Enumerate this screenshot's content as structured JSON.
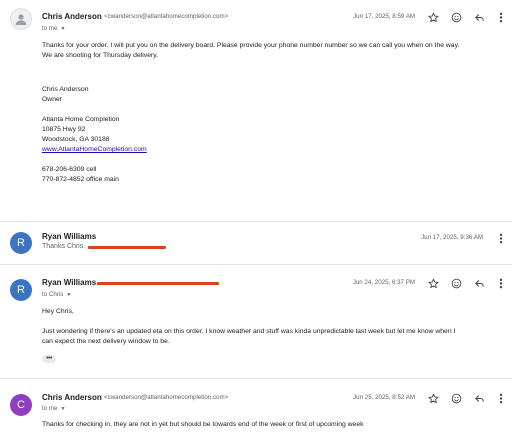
{
  "messages": [
    {
      "sender": "Chris Anderson",
      "email": "<cwanderson@atlantahomecompletion.com>",
      "to": "to me",
      "date": "Jun 17, 2025, 8:59 AM",
      "avatar_type": "default",
      "body": [
        "Thanks for your order. I will put you on the delivery board. Please provide your phone number number so we can call you when on the way.",
        "We are shooting for Thursday delivery."
      ],
      "signature": {
        "name": "Chris Anderson",
        "title": "Owner",
        "company": "Atlanta Home Completion",
        "address1": "10875 Hwy 92",
        "address2": "Woodstock, GA 30188",
        "website": "www.AtlantaHomeCompletion.com",
        "phone_cell": "678-206-6309 cell",
        "phone_office": "770-872-4852 office main"
      }
    },
    {
      "sender": "Ryan Williams",
      "snippet": "Thanks Chris.",
      "date": "Jun 17, 2025, 9:36 AM",
      "avatar_letter": "R",
      "avatar_color": "#3c74c4"
    },
    {
      "sender": "Ryan Williams",
      "to": "to Chris",
      "date": "Jun 24, 2025, 6:37 PM",
      "avatar_letter": "R",
      "avatar_color": "#3c74c4",
      "greeting": "Hey Chris,",
      "body": [
        "Just wondering if there's an updated eta on this order. I know weather and stuff was kinda unpredictable last week but let me know when I",
        "can expect the next delivery window to be."
      ],
      "ellipsis": "•••"
    },
    {
      "sender": "Chris Anderson",
      "email": "<cwanderson@atlantahomecompletion.com>",
      "to": "to me",
      "date": "Jun 25, 2025, 8:52 AM",
      "avatar_letter": "C",
      "avatar_color": "#8e3fbf",
      "body": [
        "Thanks for checking in, they are not in yet but should be towards end of the week or first of upcoming week"
      ]
    }
  ],
  "icons": {
    "star": "star-icon",
    "emoji": "emoji-icon",
    "reply": "reply-icon",
    "more": "more-vert-icon",
    "caret": "chevron-down-icon"
  },
  "colors": {
    "redaction": "#d9421d",
    "link": "#1a0dab"
  }
}
